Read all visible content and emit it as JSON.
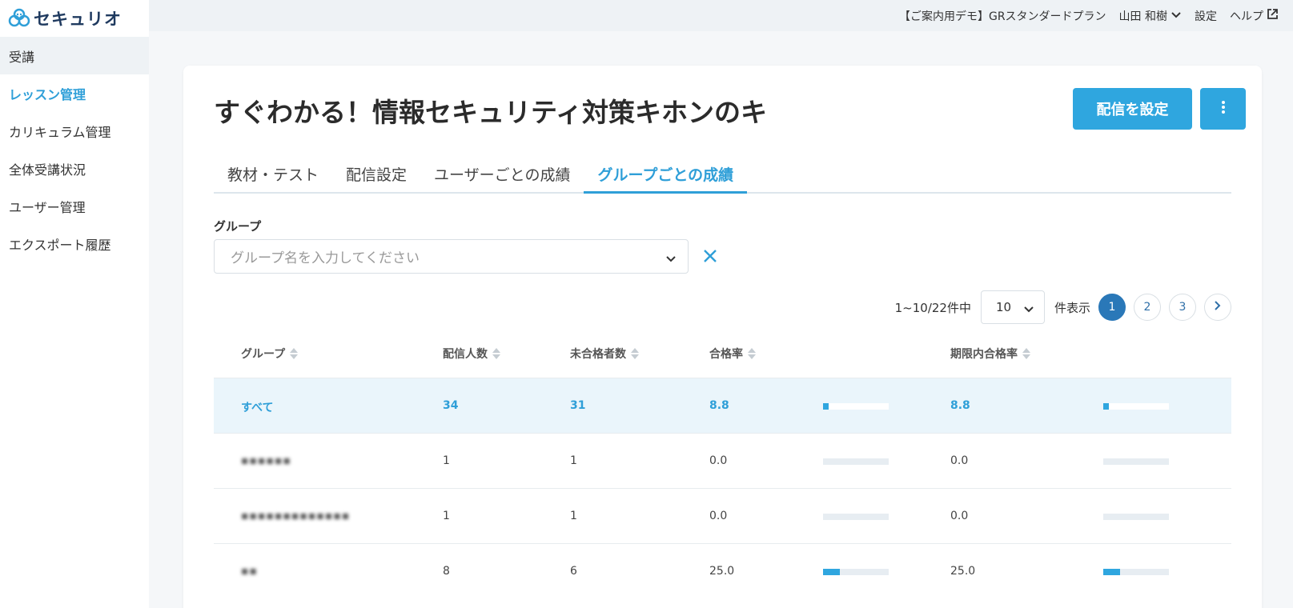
{
  "brand": {
    "name": "セキュリオ",
    "color": "#2f9fd8"
  },
  "sidebar": {
    "items": [
      {
        "label": "受講"
      },
      {
        "label": "レッスン管理"
      },
      {
        "label": "カリキュラム管理"
      },
      {
        "label": "全体受講状況"
      },
      {
        "label": "ユーザー管理"
      },
      {
        "label": "エクスポート履歴"
      }
    ]
  },
  "topbar": {
    "plan": "【ご案内用デモ】GRスタンダードプラン",
    "user": "山田 和樹",
    "settings": "設定",
    "help": "ヘルプ"
  },
  "page": {
    "title": "すぐわかる！情報セキュリティ対策キホンのキ",
    "primary_button": "配信を設定",
    "tabs": [
      {
        "label": "教材・テスト"
      },
      {
        "label": "配信設定"
      },
      {
        "label": "ユーザーごとの成績"
      },
      {
        "label": "グループごとの成績"
      }
    ],
    "active_tab": "グループごとの成績"
  },
  "filter": {
    "label": "グループ",
    "placeholder": "グループ名を入力してください"
  },
  "pagination": {
    "range_text": "1~10/22件中",
    "per_page": "10",
    "per_page_suffix": "件表示",
    "pages": [
      "1",
      "2",
      "3"
    ],
    "current_page": "1"
  },
  "table": {
    "columns": {
      "group": "グループ",
      "recipients": "配信人数",
      "not_passed": "未合格者数",
      "pass_rate": "合格率",
      "in_time_pass_rate": "期限内合格率"
    },
    "rows": [
      {
        "group": "すべて",
        "recipients": "34",
        "not_passed": "31",
        "pass_rate": "8.8",
        "in_time_pass_rate": "8.8",
        "pass_rate_value": 8.8,
        "in_time_value": 8.8
      },
      {
        "group": "",
        "recipients": "1",
        "not_passed": "1",
        "pass_rate": "0.0",
        "in_time_pass_rate": "0.0",
        "pass_rate_value": 0,
        "in_time_value": 0
      },
      {
        "group": "",
        "recipients": "1",
        "not_passed": "1",
        "pass_rate": "0.0",
        "in_time_pass_rate": "0.0",
        "pass_rate_value": 0,
        "in_time_value": 0
      },
      {
        "group": "",
        "recipients": "8",
        "not_passed": "6",
        "pass_rate": "25.0",
        "in_time_pass_rate": "25.0",
        "pass_rate_value": 25,
        "in_time_value": 25
      }
    ]
  }
}
